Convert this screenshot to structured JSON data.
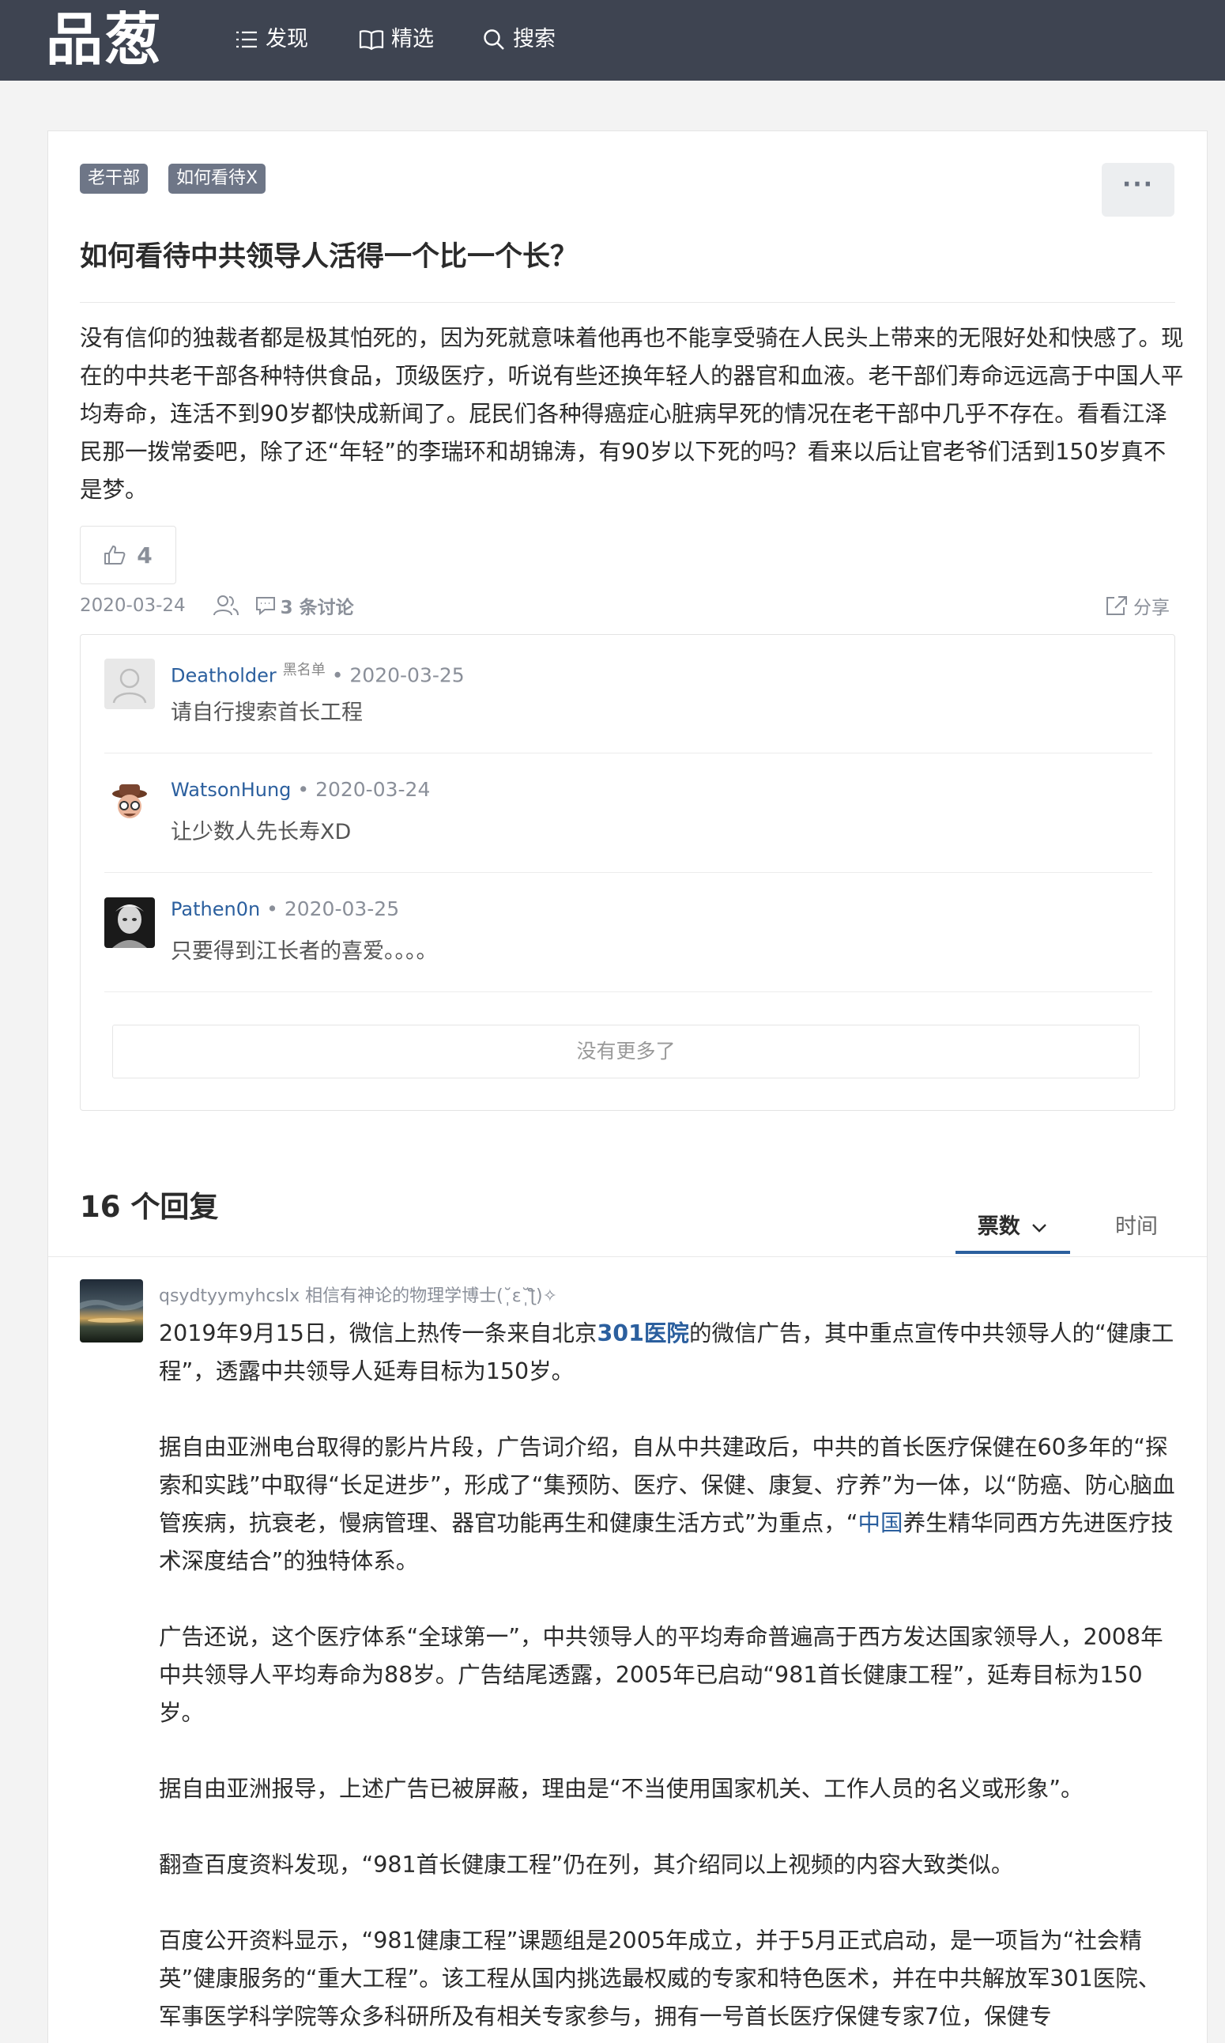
{
  "header": {
    "logo": "品葱",
    "nav": [
      {
        "label": "发现",
        "icon": "list-icon"
      },
      {
        "label": "精选",
        "icon": "book-icon"
      },
      {
        "label": "搜索",
        "icon": "search-icon"
      }
    ]
  },
  "question": {
    "tags": [
      "老干部",
      "如何看待X"
    ],
    "more_label": "···",
    "title": "如何看待中共领导人活得一个比一个长？",
    "body": "没有信仰的独裁者都是极其怕死的，因为死就意味着他再也不能享受骑在人民头上带来的无限好处和快感了。现在的中共老干部各种特供食品，顶级医疗，听说有些还换年轻人的器官和血液。老干部们寿命远远高于中国人平均寿命，连活不到90岁都快成新闻了。屁民们各种得癌症心脏病早死的情况在老干部中几乎不存在。看看江泽民那一拨常委吧，除了还“年轻”的李瑞环和胡锦涛，有90岁以下死的吗？看来以后让官老爷们活到150岁真不是梦。",
    "likes": "4",
    "date": "2020-03-24",
    "discussion": "3 条讨论",
    "share": "分享"
  },
  "comments": [
    {
      "user": "Deatholder",
      "badge": "黑名单",
      "sep": " • ",
      "date": "2020-03-25",
      "text": "请自行搜索首长工程"
    },
    {
      "user": "WatsonHung",
      "badge": "",
      "sep": " • ",
      "date": "2020-03-24",
      "text": "让少数人先长寿XD"
    },
    {
      "user": "Pathen0n",
      "badge": "",
      "sep": " • ",
      "date": "2020-03-25",
      "text": "只要得到江长者的喜爱。。。。"
    }
  ],
  "no_more": "没有更多了",
  "replies": {
    "title": "16 个回复",
    "sort_votes": "票数",
    "sort_time": "时间"
  },
  "answer": {
    "user": "qsydtyymyhcslx",
    "signature": "相信有神论的物理学博士(˘̩̩̩ε˘̩ƪ)✧",
    "p1_a": "2019年9月15日，微信上热传一条来自北京",
    "p1_link": "301医院",
    "p1_b": "的微信广告，其中重点宣传中共领导人的“健康工程”，透露中共领导人延寿目标为150岁。",
    "p2_a": "据自由亚洲电台取得的影片片段，广告词介绍，自从中共建政后，中共的首长医疗保健在60多年的“探索和实践”中取得“长足进步”，形成了“集预防、医疗、保健、康复、疗养”为一体，以“防癌、防心脑血管疾病，抗衰老，慢病管理、器官功能再生和健康生活方式”为重点，“",
    "p2_link": "中国",
    "p2_b": "养生精华同西方先进医疗技术深度结合”的独特体系。",
    "p3": "广告还说，这个医疗体系“全球第一”，中共领导人的平均寿命普遍高于西方发达国家领导人，2008年中共领导人平均寿命为88岁。广告结尾透露，2005年已启动“981首长健康工程”，延寿目标为150岁。",
    "p4": "据自由亚洲报导，上述广告已被屏蔽，理由是“不当使用国家机关、工作人员的名义或形象”。",
    "p5": "翻查百度资料发现，“981首长健康工程”仍在列，其介绍同以上视频的内容大致类似。",
    "p6": "百度公开资料显示，“981健康工程”课题组是2005年成立，并于5月正式启动，是一项旨为“社会精英”健康服务的“重大工程”。该工程从国内挑选最权威的专家和特色医术，并在中共解放军301医院、军事医学科学院等众多科研所及有相关专家参与，拥有一号首长医疗保健专家7位，保健专"
  }
}
